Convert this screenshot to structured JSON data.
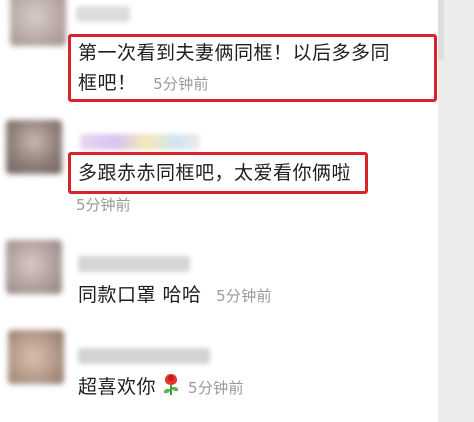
{
  "comments": [
    {
      "text_line1": "第一次看到夫妻俩同框！以后多多同",
      "text_line2": "框吧！",
      "time": "5分钟前",
      "avatar_color": "#c7b9b4",
      "username_color": "#dcdcdc",
      "highlighted": true
    },
    {
      "text_line1": "多跟赤赤同框吧，太爱看你俩啦",
      "time": "5分钟前",
      "avatar_color": "#9d8f89",
      "username_color": "#e6cfe6",
      "highlighted": true
    },
    {
      "text_line1": "同款口罩 哈哈",
      "time": "5分钟前",
      "avatar_color": "#b8a9a6",
      "username_color": "#d7d7d7",
      "highlighted": false
    },
    {
      "text_line1": "超喜欢你",
      "time": "5分钟前",
      "avatar_color": "#b59a8a",
      "username_color": "#d3d3d3",
      "highlighted": false,
      "emoji": "rose-icon"
    }
  ],
  "colors": {
    "highlight_border": "#d6242a",
    "timestamp": "#9a9a9a",
    "text": "#1f1f1f"
  }
}
